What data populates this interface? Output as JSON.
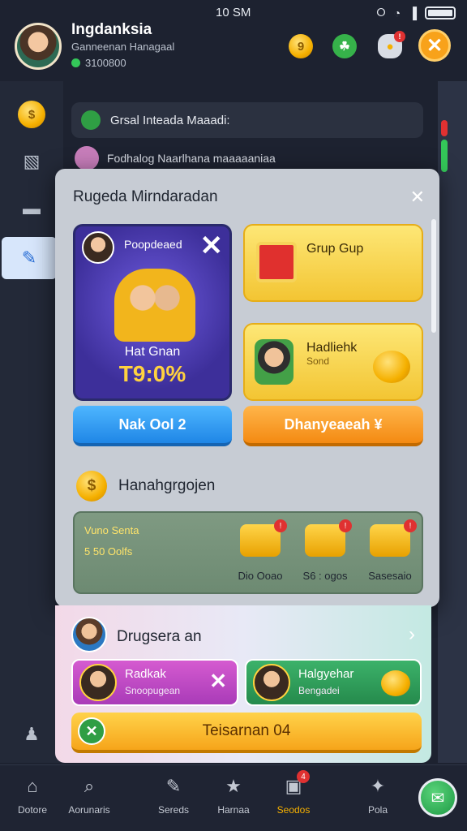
{
  "status_bar": {
    "time": "10 SM"
  },
  "header": {
    "user_name": "Ingdanksia",
    "user_subtitle": "Ganneenan Hanagaal",
    "user_id": "3100800",
    "coin_badge": "9"
  },
  "background": {
    "notice_text": "Grsal Inteada Maaadi:",
    "row_text": "Fodhalog Naarlhana  maaaaaniaa"
  },
  "modal": {
    "title": "Rugeda Mirndaradan",
    "promo": {
      "name": "Poopdeaed",
      "label": "Hat Gnan",
      "value": "T9:0%"
    },
    "tile_gift": {
      "title": "Grup Gup"
    },
    "tile_profile": {
      "title": "Hadliehk",
      "subtitle": "Sond"
    },
    "btn_left": "Nak Ool 2",
    "btn_right": "Dhanyeaeah ¥",
    "section_title": "Hanahgrgojen",
    "rewards": {
      "label": "Vuno Senta",
      "value": "5 50 Oolfs",
      "items": [
        {
          "caption": "Dio Ooao"
        },
        {
          "caption": "S6 : ogos"
        },
        {
          "caption": "Sasesaio"
        }
      ]
    }
  },
  "panel2": {
    "title": "Drugsera an",
    "card_pink": {
      "title": "Radkak",
      "subtitle": "Snoopugean"
    },
    "card_green": {
      "title": "Halgyehar",
      "subtitle": "Bengadei"
    },
    "cta_label": "Teisarnan 04"
  },
  "bottom_nav": [
    {
      "label": "Dotore",
      "icon": "home-icon"
    },
    {
      "label": "Aorunaris",
      "icon": "search-icon"
    },
    {
      "label": "Sereds",
      "icon": "pencil-icon"
    },
    {
      "label": "Harnaa",
      "icon": "star-icon"
    },
    {
      "label": "Seodos",
      "icon": "edit-icon",
      "badge": "4"
    },
    {
      "label": "Pola",
      "icon": "sparkle-icon"
    }
  ]
}
